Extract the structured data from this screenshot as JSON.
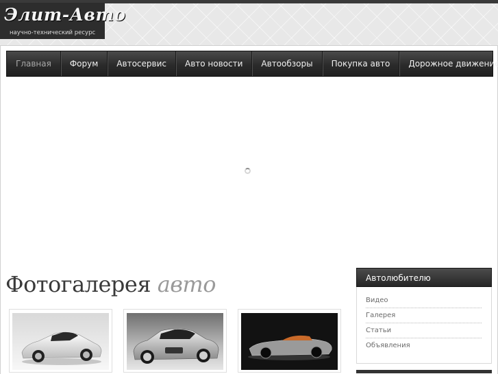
{
  "header": {
    "logo_title": "Элит-Авто",
    "logo_subtitle": "научно-технический ресурс"
  },
  "nav": {
    "items": [
      "Главная",
      "Форум",
      "Автосервис",
      "Авто новости",
      "Автообзоры",
      "Покупка авто",
      "Дорожное движение"
    ],
    "active_index": 0
  },
  "slider": {
    "state_icon": "loading-spinner-icon"
  },
  "gallery": {
    "title_main": "Фотогалерея",
    "title_accent": "авто",
    "photos": [
      "white sports car",
      "silver sedan",
      "silver concept roadster"
    ]
  },
  "sidebar": {
    "heading": "Автолюбителю",
    "links": [
      "Видео",
      "Галерея",
      "Статьи",
      "Объявления"
    ]
  },
  "colors": {
    "nav_bg": "#2b2b2b",
    "accent_text": "#9a9a9a",
    "frame_border": "#cfcfcf"
  }
}
